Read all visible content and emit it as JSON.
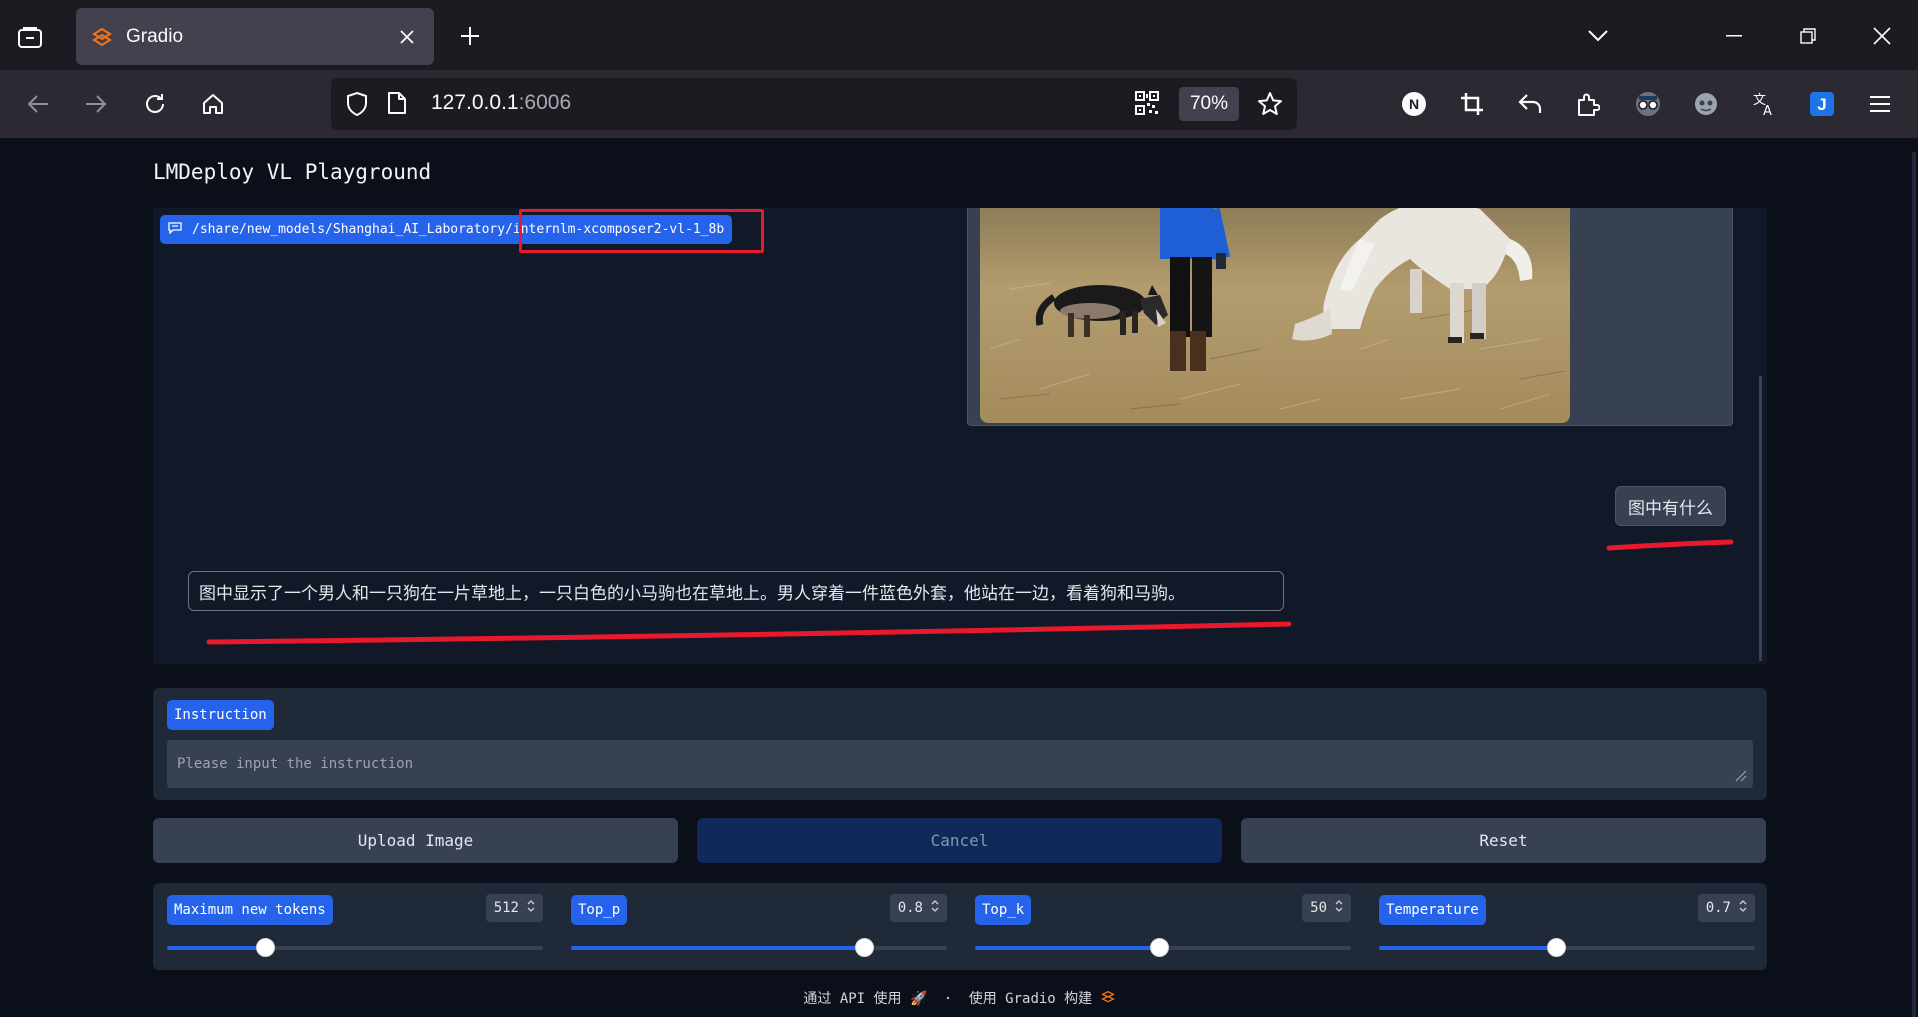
{
  "browser": {
    "tab_title": "Gradio",
    "url_host": "127.0.0.1",
    "url_port": ":6006",
    "zoom": "70%"
  },
  "app": {
    "title": "LMDeploy VL Playground"
  },
  "chat": {
    "model_path": "/share/new_models/Shanghai_AI_Laboratory/internlm-xcomposer2-vl-1_8b",
    "user_message": "图中有什么",
    "bot_message": "图中显示了一个男人和一只狗在一片草地上，一只白色的小马驹也在草地上。男人穿着一件蓝色外套，他站在一边，看着狗和马驹。"
  },
  "instruction": {
    "label": "Instruction",
    "placeholder": "Please input the instruction",
    "value": ""
  },
  "buttons": {
    "upload": "Upload Image",
    "cancel": "Cancel",
    "reset": "Reset"
  },
  "params": [
    {
      "label": "Maximum new tokens",
      "value": "512",
      "fill_fraction": 0.26
    },
    {
      "label": "Top_p",
      "value": "0.8",
      "fill_fraction": 0.78
    },
    {
      "label": "Top_k",
      "value": "50",
      "fill_fraction": 0.49
    },
    {
      "label": "Temperature",
      "value": "0.7",
      "fill_fraction": 0.47
    }
  ],
  "footer": {
    "api_text": "通过 API 使用",
    "sep": "·",
    "built_text": "使用 Gradio 构建"
  },
  "colors": {
    "accent": "#2563eb",
    "annotation_red": "#e8192c"
  }
}
